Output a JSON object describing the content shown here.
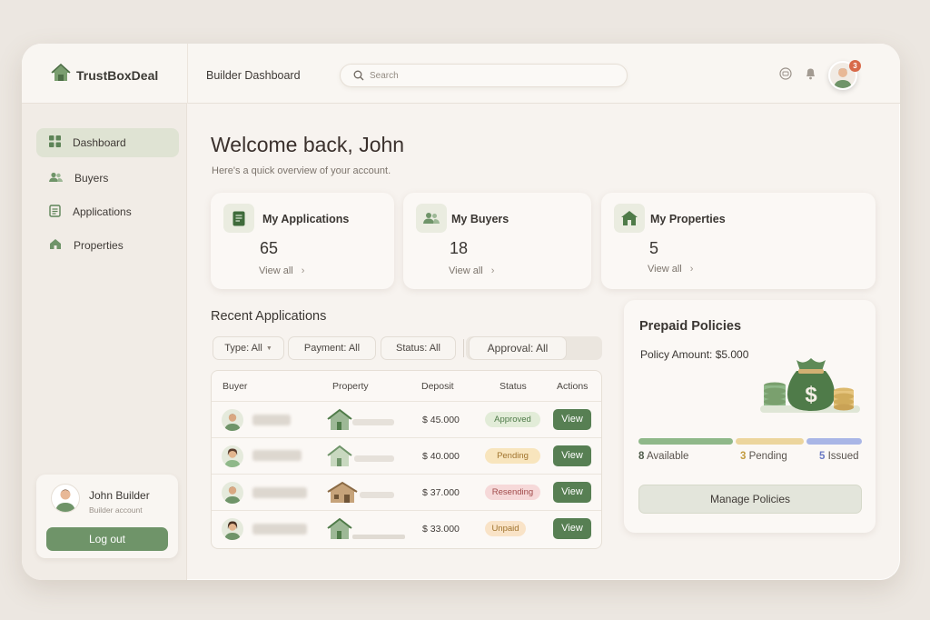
{
  "app": {
    "name": "TrustBoxDeal",
    "page_title": "Builder Dashboard"
  },
  "search": {
    "placeholder": "Search"
  },
  "notifications": {
    "count": "3"
  },
  "sidebar": {
    "items": [
      {
        "label": "Dashboard",
        "icon": "grid-icon",
        "active": true
      },
      {
        "label": "Buyers",
        "icon": "users-icon",
        "active": false
      },
      {
        "label": "Applications",
        "icon": "document-icon",
        "active": false
      },
      {
        "label": "Properties",
        "icon": "house-icon",
        "active": false
      }
    ],
    "user": {
      "name": "John Builder",
      "role": "Builder account",
      "logout": "Log out"
    }
  },
  "main": {
    "welcome": "Welcome back, John",
    "subtitle": "Here's a quick overview of your account.",
    "stats": [
      {
        "label": "My Applications",
        "value": "65",
        "link": "View all",
        "icon": "clipboard-icon"
      },
      {
        "label": "My Buyers",
        "value": "18",
        "link": "View all",
        "icon": "users-icon"
      },
      {
        "label": "My Properties",
        "value": "5",
        "link": "View all",
        "icon": "house-icon"
      }
    ],
    "recent_title": "Recent Applications",
    "filters": {
      "type": "Type: All",
      "payment": "Payment: All",
      "status": "Status: All",
      "approval": "Approval: All"
    },
    "table": {
      "headers": {
        "buyer": "Buyer",
        "property": "Property",
        "deposit": "Deposit",
        "status": "Status",
        "actions": "Actions"
      },
      "rows": [
        {
          "deposit": "$ 45.000",
          "status": "Approved",
          "action": "View"
        },
        {
          "deposit": "$ 40.000",
          "status": "Pending",
          "action": "View"
        },
        {
          "deposit": "$ 37.000",
          "status": "Resending",
          "action": "View"
        },
        {
          "deposit": "$ 33.000",
          "status": "Unpaid",
          "action": "View"
        }
      ]
    }
  },
  "policies": {
    "title": "Prepaid Policies",
    "amount": "Policy Amount: $5.000",
    "available_count": "8",
    "available_label": "Available",
    "pending_count": "3",
    "pending_label": "Pending",
    "issued_count": "5",
    "issued_label": "Issued",
    "manage": "Manage Policies"
  },
  "colors": {
    "accent": "#6f9469",
    "button": "#577f53",
    "approved_bg": "#e2ecd8",
    "pending_bg": "#f8e5bd",
    "resending_bg": "#f6d9d9",
    "unpaid_bg": "#f9e3c7",
    "bar_available": "#8fb889",
    "bar_pending": "#ecd59d",
    "bar_issued": "#a9b6e6"
  }
}
